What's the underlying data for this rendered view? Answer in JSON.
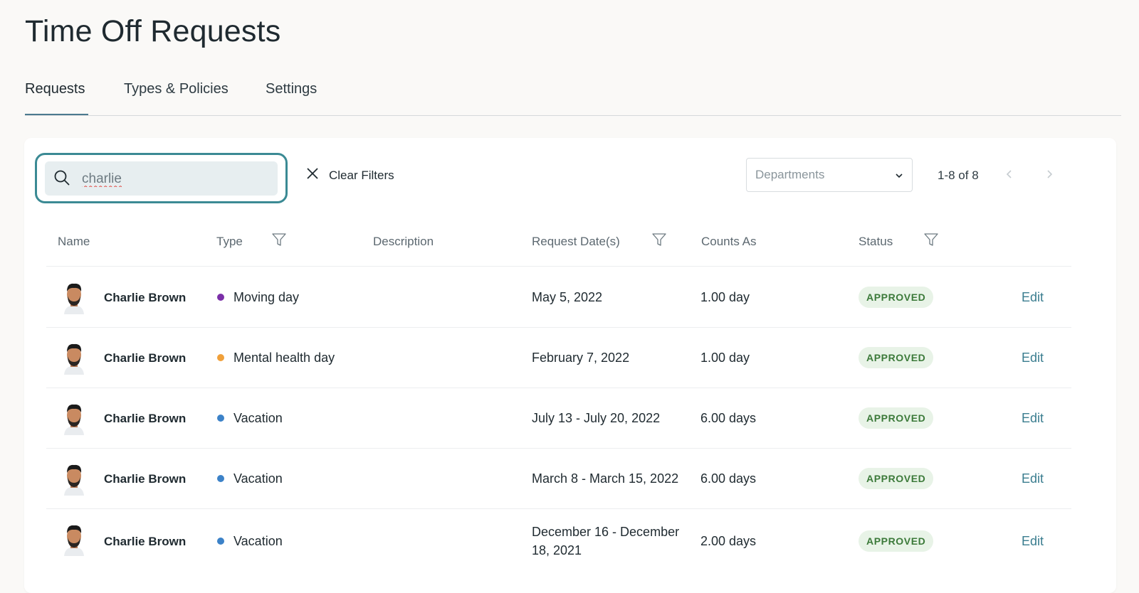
{
  "page": {
    "title": "Time Off Requests"
  },
  "tabs": [
    {
      "label": "Requests",
      "active": true
    },
    {
      "label": "Types & Policies",
      "active": false
    },
    {
      "label": "Settings",
      "active": false
    }
  ],
  "toolbar": {
    "search_value": "charlie",
    "clear_filters_label": "Clear Filters",
    "departments_placeholder": "Departments",
    "pagination_text": "1-8 of 8"
  },
  "table": {
    "headers": {
      "name": "Name",
      "type": "Type",
      "description": "Description",
      "request_dates": "Request Date(s)",
      "counts_as": "Counts As",
      "status": "Status"
    },
    "rows": [
      {
        "name": "Charlie Brown",
        "type": "Moving day",
        "type_color": "#7b2fa8",
        "dates": "May 5, 2022",
        "counts_as": "1.00 day",
        "status": "APPROVED",
        "action": "Edit"
      },
      {
        "name": "Charlie Brown",
        "type": "Mental health day",
        "type_color": "#f0a03a",
        "dates": "February 7, 2022",
        "counts_as": "1.00 day",
        "status": "APPROVED",
        "action": "Edit"
      },
      {
        "name": "Charlie Brown",
        "type": "Vacation",
        "type_color": "#3c82c8",
        "dates": "July 13 - July 20, 2022",
        "counts_as": "6.00 days",
        "status": "APPROVED",
        "action": "Edit"
      },
      {
        "name": "Charlie Brown",
        "type": "Vacation",
        "type_color": "#3c82c8",
        "dates": "March 8 - March 15, 2022",
        "counts_as": "6.00 days",
        "status": "APPROVED",
        "action": "Edit"
      },
      {
        "name": "Charlie Brown",
        "type": "Vacation",
        "type_color": "#3c82c8",
        "dates_line1": "December 16 - December",
        "dates_line2": "18, 2021",
        "counts_as": "2.00 days",
        "status": "APPROVED",
        "action": "Edit"
      }
    ]
  },
  "colors": {
    "accent": "#3b8a94",
    "link": "#3a7d8f",
    "approved_bg": "#e8f3e7",
    "approved_text": "#3c7a3a"
  }
}
